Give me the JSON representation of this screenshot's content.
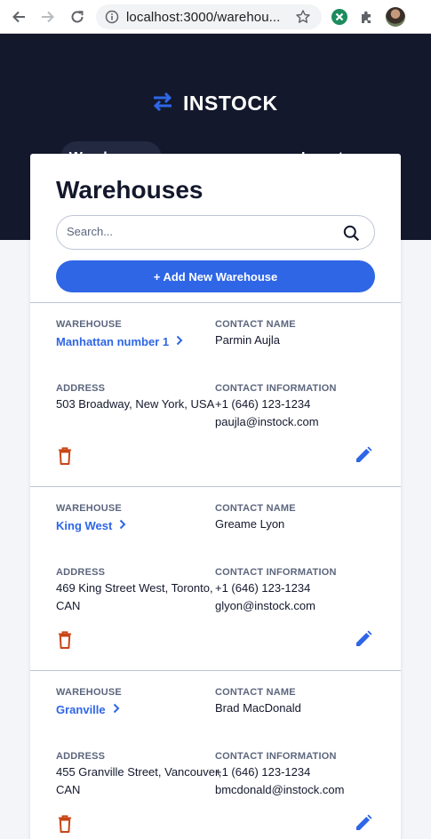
{
  "browser": {
    "url": "localhost:3000/warehou..."
  },
  "app": {
    "logo_text": "INSTOCK",
    "nav": [
      {
        "label": "Warehouses"
      },
      {
        "label": "Inventory"
      }
    ],
    "accent": "#2e66e6",
    "header_bg": "#13182c",
    "danger": "#c94515"
  },
  "main": {
    "title": "Warehouses",
    "search_placeholder": "Search...",
    "add_button": "+ Add New Warehouse",
    "labels": {
      "warehouse": "WAREHOUSE",
      "contact_name": "CONTACT NAME",
      "address": "ADDRESS",
      "contact_info": "CONTACT INFORMATION"
    },
    "warehouses": [
      {
        "name": "Manhattan number 1",
        "contact": "Parmin Aujla",
        "address_line1": "503 Broadway, New York, USA",
        "address_line2": "",
        "phone": "+1 (646) 123-1234",
        "email": "paujla@instock.com"
      },
      {
        "name": "King West",
        "contact": "Greame Lyon",
        "address_line1": "469 King Street West, Toronto,",
        "address_line2": "CAN",
        "phone": "+1 (646) 123-1234",
        "email": "glyon@instock.com"
      },
      {
        "name": "Granville",
        "contact": "Brad MacDonald",
        "address_line1": "455 Granville Street, Vancouver,",
        "address_line2": "CAN",
        "phone": "+1 (646) 123-1234",
        "email": "bmcdonald@instock.com"
      }
    ]
  }
}
